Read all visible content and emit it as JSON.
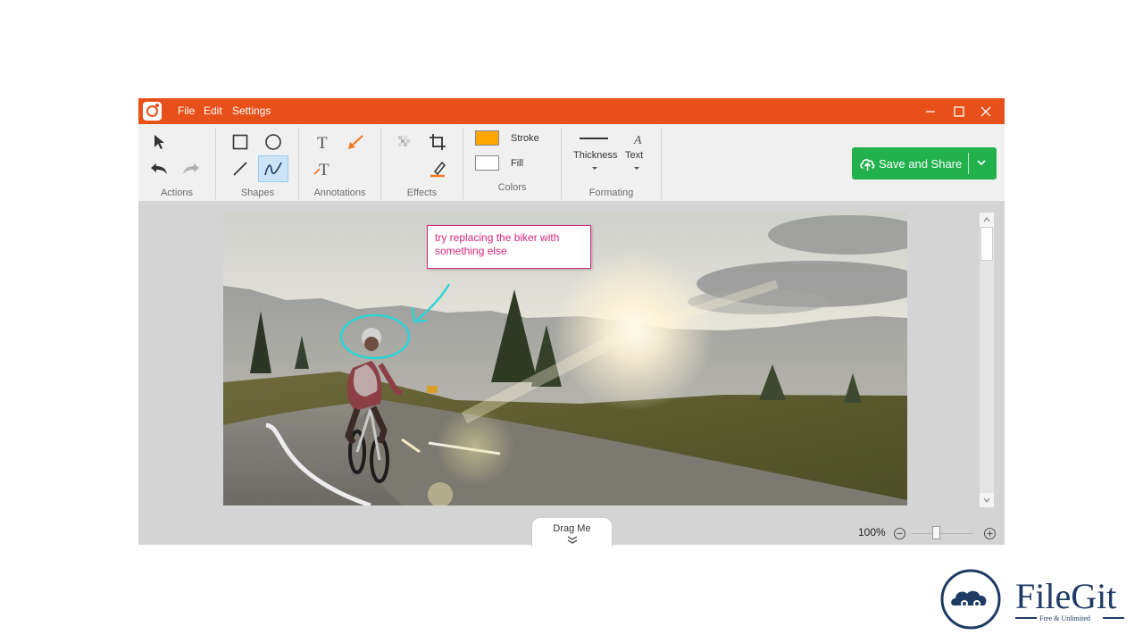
{
  "titlebar": {
    "menus": [
      "File",
      "Edit",
      "Settings"
    ],
    "accent": "#e8501a"
  },
  "toolbar": {
    "groups": {
      "actions": "Actions",
      "shapes": "Shapes",
      "annotations": "Annotations",
      "effects": "Effects",
      "colors": "Colors",
      "formatting": "Formating"
    },
    "stroke_label": "Stroke",
    "fill_label": "Fill",
    "stroke_color": "#ffa500",
    "fill_color": "#ffffff",
    "thickness_label": "Thickness",
    "text_label": "Text",
    "save_label": "Save and Share",
    "save_color": "#22b14c"
  },
  "canvas": {
    "annotation_text": "try replacing the biker with something else",
    "annotation_color": "#d9257d",
    "ellipse_color": "#2bd3d8",
    "drag_label": "Drag Me",
    "zoom": "100%"
  },
  "watermark": {
    "brand": "FileGit",
    "tagline": "Free & Unlimited"
  }
}
